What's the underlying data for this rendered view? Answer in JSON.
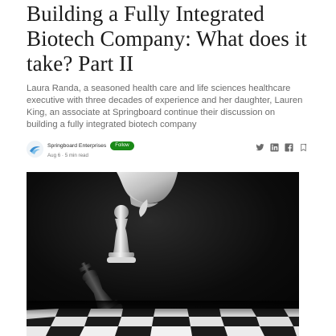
{
  "article": {
    "title": "Building a Fully Integrated Biotech Company: What does it take? Part II",
    "subtitle": "Laura Randa, a seasoned health care and life sciences healthcare executive with three decades of experience and her daughter, Lauren King, an associate at Springboard continue their discussion on building a fully integrated biotech company"
  },
  "author": {
    "name": "Springboard Enterprises",
    "follow_label": "Follow",
    "date": "Aug 6",
    "separator": "·",
    "read_time": "5 min read"
  },
  "share": {
    "icons": [
      "twitter-icon",
      "linkedin-icon",
      "facebook-icon",
      "bookmark-icon"
    ]
  },
  "colors": {
    "follow_green": "#1a8917",
    "title": "#1a1a1a",
    "subtitle": "#6b6b6b",
    "meta": "#757575"
  },
  "hero_image": {
    "subject": "chess pieces on a board"
  }
}
